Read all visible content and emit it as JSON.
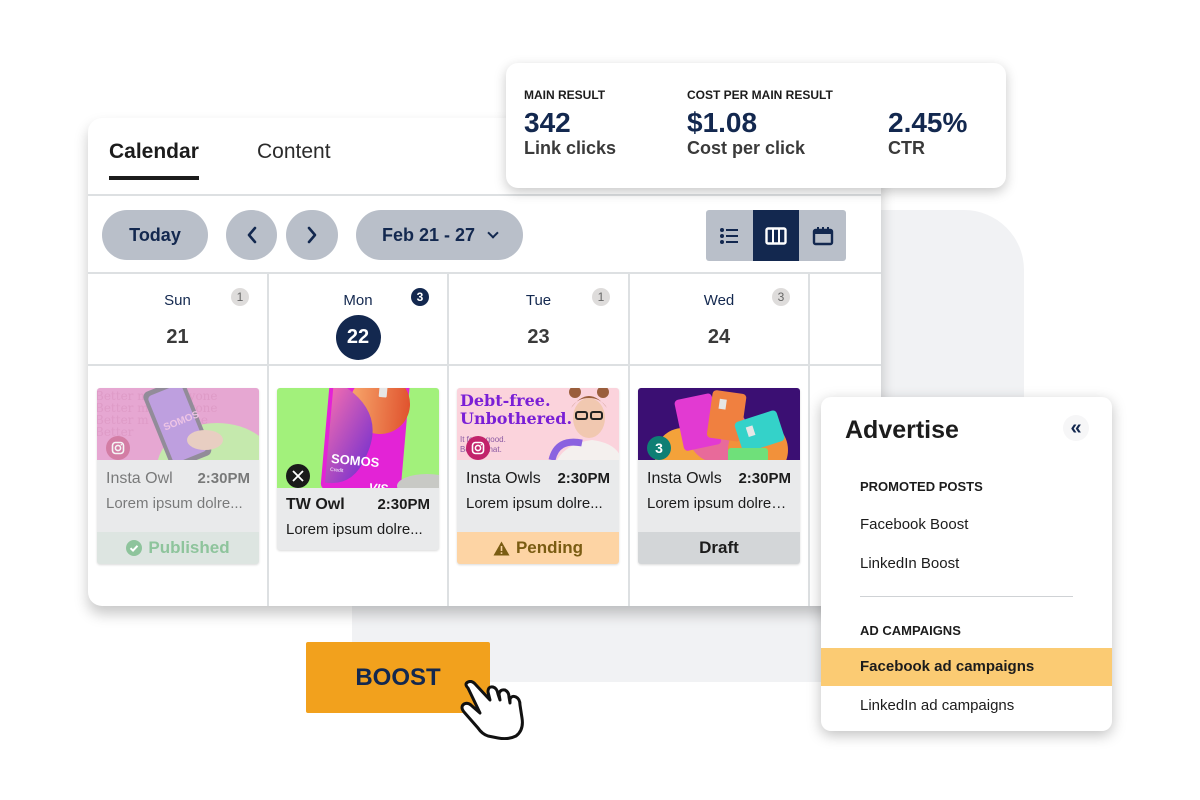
{
  "metrics": {
    "main_result": {
      "label": "MAIN RESULT",
      "value": "342",
      "sub": "Link clicks"
    },
    "cost_per_result": {
      "label": "COST PER MAIN RESULT",
      "value": "$1.08",
      "sub": "Cost per click"
    },
    "ctr": {
      "label": "",
      "value": "2.45%",
      "sub": "CTR"
    }
  },
  "tabs": [
    {
      "label": "Calendar",
      "active": true
    },
    {
      "label": "Content",
      "active": false
    }
  ],
  "toolbar": {
    "today_label": "Today",
    "prev_icon": "chevron-left-icon",
    "next_icon": "chevron-right-icon",
    "date_range": "Feb 21 - 27",
    "views": [
      {
        "icon": "list-view-icon",
        "active": false
      },
      {
        "icon": "week-columns-icon",
        "active": true
      },
      {
        "icon": "month-calendar-icon",
        "active": false
      }
    ]
  },
  "days": [
    {
      "dow": "Sun",
      "date": "21",
      "count": "1",
      "today": false
    },
    {
      "dow": "Mon",
      "date": "22",
      "count": "3",
      "today": true
    },
    {
      "dow": "Tue",
      "date": "23",
      "count": "1",
      "today": false
    },
    {
      "dow": "Wed",
      "date": "24",
      "count": "3",
      "today": false
    }
  ],
  "posts": [
    {
      "network": "instagram",
      "name": "Insta Owl",
      "time": "2:30PM",
      "desc": "Lorem ipsum dolre...",
      "status": "Published",
      "status_icon": "check-circle-icon",
      "image_text": "SOMOS",
      "bg_text": "Better m for everyone"
    },
    {
      "network": "x",
      "name": "TW Owl",
      "time": "2:30PM",
      "desc": "Lorem ipsum dolre...",
      "status": "",
      "image_text": "SOMOS",
      "image_subtext": "Credit",
      "card_brand": "VISA"
    },
    {
      "network": "instagram",
      "name": "Insta Owls",
      "time": "2:30PM",
      "desc": "Lorem ipsum dolre...",
      "status": "Pending",
      "status_icon": "warning-icon",
      "headline_1": "Debt-free.",
      "headline_2": "Unbothered.",
      "tagline_1": "It feels good.",
      "tagline_2": "Be like that."
    },
    {
      "network": "multi",
      "network_count": "3",
      "name": "Insta Owls",
      "time": "2:30PM",
      "desc": "Lorem ipsum dolrem...",
      "status": "Draft"
    }
  ],
  "advertise": {
    "title": "Advertise",
    "collapse_icon": "double-chevron-left-icon",
    "sections": [
      {
        "label": "PROMOTED POSTS",
        "items": [
          {
            "label": "Facebook Boost",
            "active": false
          },
          {
            "label": "LinkedIn Boost",
            "active": false
          }
        ]
      },
      {
        "label": "AD CAMPAIGNS",
        "items": [
          {
            "label": "Facebook ad campaigns",
            "active": true
          },
          {
            "label": "LinkedIn ad campaigns",
            "active": false
          }
        ]
      }
    ]
  },
  "boost": {
    "label": "BOOST"
  },
  "colors": {
    "navy": "#13284f",
    "boost_orange": "#f2a11d",
    "highlight": "#fbcb73",
    "pending_bg": "#fdd4a4",
    "instagram": "#c2236b"
  }
}
